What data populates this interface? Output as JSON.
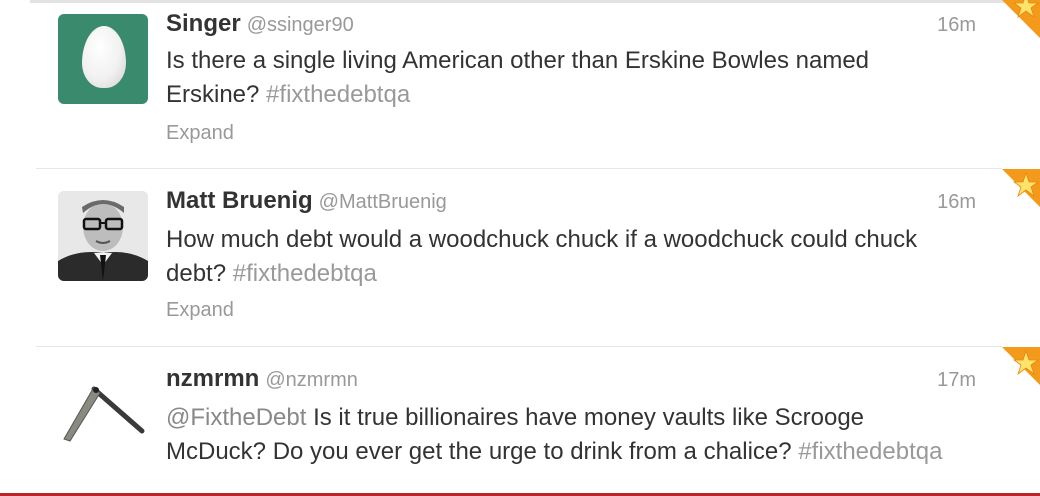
{
  "tweets": [
    {
      "fullname": "Singer",
      "username": "@ssinger90",
      "time": "16m",
      "text_before": "Is there a single living American other than Erskine Bowles named Erskine?",
      "hashtag": "#fixthedebtqa",
      "expand": "Expand",
      "avatar": "egg-avatar"
    },
    {
      "fullname": "Matt Bruenig",
      "username": "@MattBruenig",
      "time": "16m",
      "text_before": "How much debt would a woodchuck chuck if a woodchuck could chuck debt?",
      "hashtag": "#fixthedebtqa",
      "expand": "Expand",
      "avatar": "portrait-avatar"
    },
    {
      "fullname": "nzmrmn",
      "username": "@nzmrmn",
      "time": "17m",
      "mention": "@FixtheDebt",
      "text_before": "Is it true billionaires have money vaults like Scrooge McDuck? Do you ever get the urge to drink from a chalice?",
      "hashtag": "#fixthedebtqa",
      "avatar": "straight-razor-avatar"
    }
  ],
  "colors": {
    "fav_corner": "#f39a1c",
    "egg_bg": "#3a8a6e",
    "bottom_bar": "#b8262a"
  }
}
